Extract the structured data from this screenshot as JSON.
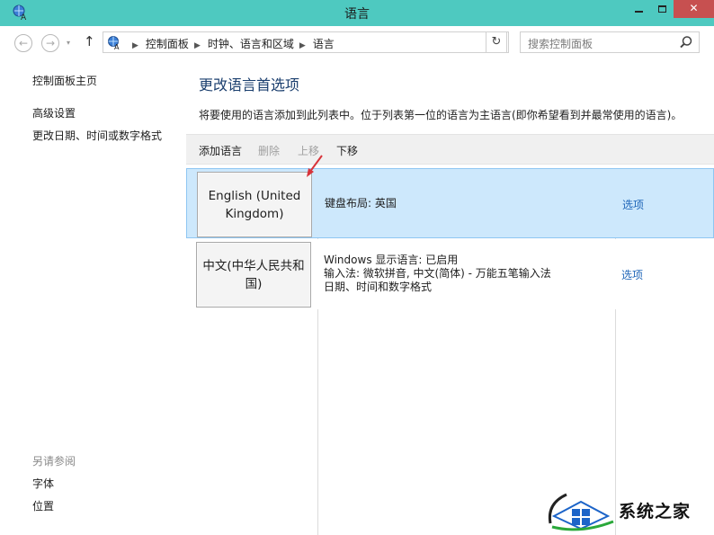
{
  "window": {
    "title": "语言",
    "close_glyph": "✕",
    "icon": "language-control-panel-icon"
  },
  "nav": {
    "back_glyph": "←",
    "forward_glyph": "→",
    "dropdown_glyph": "▾",
    "up_glyph": "↑",
    "refresh_glyph": "↻",
    "breadcrumb": [
      "控制面板",
      "时钟、语言和区域",
      "语言"
    ],
    "breadcrumb_sep": "▶",
    "search_placeholder": "搜索控制面板"
  },
  "sidebar": {
    "home": "控制面板主页",
    "links": [
      "高级设置",
      "更改日期、时间或数字格式"
    ],
    "see_also_title": "另请参阅",
    "see_also": [
      "字体",
      "位置"
    ]
  },
  "main": {
    "heading": "更改语言首选项",
    "description": "将要使用的语言添加到此列表中。位于列表第一位的语言为主语言(即你希望看到并最常使用的语言)。",
    "toolbar": {
      "add": "添加语言",
      "remove": "删除",
      "move_up": "上移",
      "move_down": "下移"
    },
    "languages": [
      {
        "name": "English (United Kingdom)",
        "info": [
          "键盘布局: 英国"
        ],
        "options": "选项",
        "selected": true
      },
      {
        "name": "中文(中华人民共和国)",
        "info": [
          "Windows 显示语言: 已启用",
          "输入法: 微软拼音, 中文(简体) - 万能五笔输入法",
          "日期、时间和数字格式"
        ],
        "options": "选项",
        "selected": false
      }
    ]
  },
  "watermark": {
    "text": "系统之家"
  },
  "colors": {
    "titlebar": "#4ec9c0",
    "close_button": "#c75050",
    "selected_row": "#cde8fc",
    "link": "#1e65b8",
    "heading": "#1a3e6e",
    "arrow": "#d8333a"
  }
}
